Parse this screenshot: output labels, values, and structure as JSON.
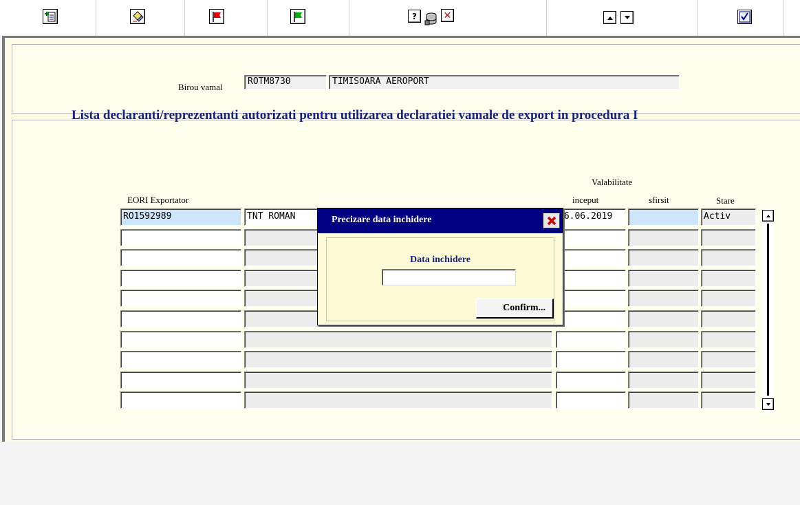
{
  "toolbar": {
    "buttons": [
      {
        "name": "add-record-icon"
      },
      {
        "name": "erase-icon"
      },
      {
        "name": "red-flag-icon"
      },
      {
        "name": "green-flag-icon"
      },
      {
        "name": "help-icon",
        "glyph": "?"
      },
      {
        "name": "database-icon"
      },
      {
        "name": "delete-icon",
        "glyph": "✕"
      },
      {
        "name": "scroll-up-icon"
      },
      {
        "name": "scroll-down-icon"
      },
      {
        "name": "checkbox-icon"
      }
    ]
  },
  "office": {
    "label": "Birou vamal",
    "code": "ROTM8730",
    "name": "TIMISOARA AEROPORT"
  },
  "list": {
    "title": "Lista declaranti/reprezentanti autorizati pentru utilizarea declaratiei vamale de export in procedura I",
    "headers": {
      "eori": "EORI Exportator",
      "validity_group": "Valabilitate",
      "start": "inceput",
      "end": "sfirsit",
      "status": "Stare"
    },
    "rows": [
      {
        "eori": "RO1592989",
        "name": "TNT ROMAN",
        "start": "26.06.2019",
        "end": "",
        "status": "Activ"
      },
      {
        "eori": "",
        "name": "",
        "start": "",
        "end": "",
        "status": ""
      },
      {
        "eori": "",
        "name": "",
        "start": "",
        "end": "",
        "status": ""
      },
      {
        "eori": "",
        "name": "",
        "start": "",
        "end": "",
        "status": ""
      },
      {
        "eori": "",
        "name": "",
        "start": "",
        "end": "",
        "status": ""
      },
      {
        "eori": "",
        "name": "",
        "start": "",
        "end": "",
        "status": ""
      },
      {
        "eori": "",
        "name": "",
        "start": "",
        "end": "",
        "status": ""
      },
      {
        "eori": "",
        "name": "",
        "start": "",
        "end": "",
        "status": ""
      },
      {
        "eori": "",
        "name": "",
        "start": "",
        "end": "",
        "status": ""
      },
      {
        "eori": "",
        "name": "",
        "start": "",
        "end": "",
        "status": ""
      }
    ]
  },
  "dialog": {
    "title": "Precizare data inchidere",
    "field_label": "Data inchidere",
    "field_value": "",
    "confirm_label": "Confirm..."
  },
  "colors": {
    "title_blue": "#1a237e",
    "dialog_titlebar": "#000080",
    "panel_bg": "#ffffee",
    "selected_row": "#cde6fb"
  }
}
